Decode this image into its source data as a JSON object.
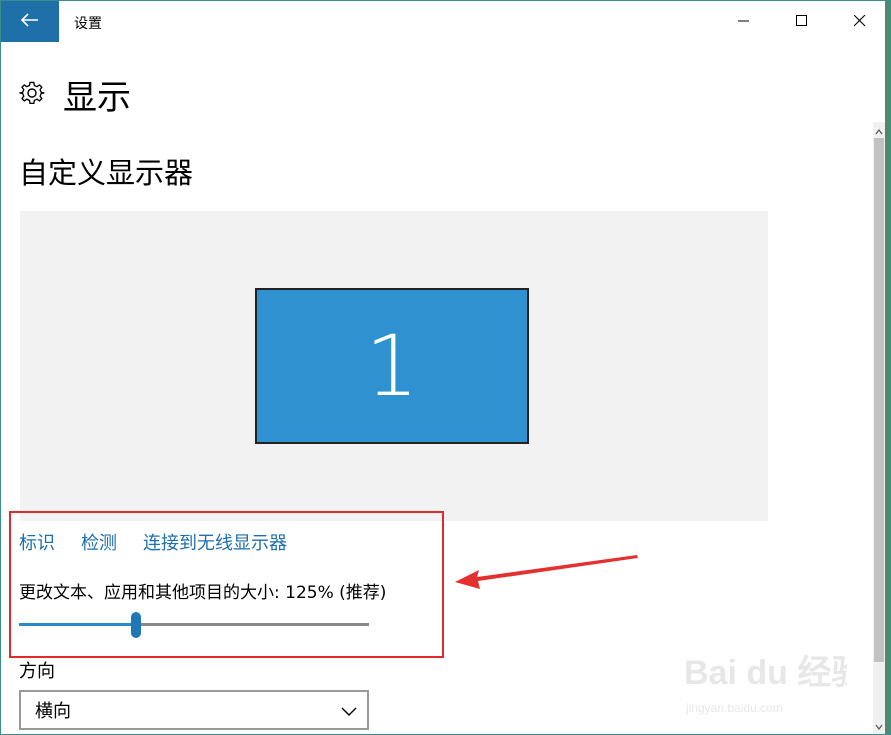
{
  "window": {
    "title": "设置",
    "back_icon": "arrow-left-icon",
    "minimize_icon": "minimize-icon",
    "maximize_icon": "maximize-icon",
    "close_icon": "close-icon"
  },
  "header": {
    "icon": "gear-icon",
    "title": "显示"
  },
  "main": {
    "section_title": "自定义显示器",
    "monitor_number": "1",
    "links": [
      "标识",
      "检测",
      "连接到无线显示器"
    ],
    "scale": {
      "label": "更改文本、应用和其他项目的大小: 125% (推荐)",
      "slider_fraction": 0.335
    },
    "orientation": {
      "label": "方向",
      "value": "横向"
    }
  },
  "colors": {
    "accent": "#1f6fa8",
    "monitor": "#2f91cf",
    "link": "#1e6fae",
    "highlight": "#e02b2b"
  },
  "watermark": {
    "text": "Bai du 经验",
    "url": "jingyan.baidu.com"
  }
}
